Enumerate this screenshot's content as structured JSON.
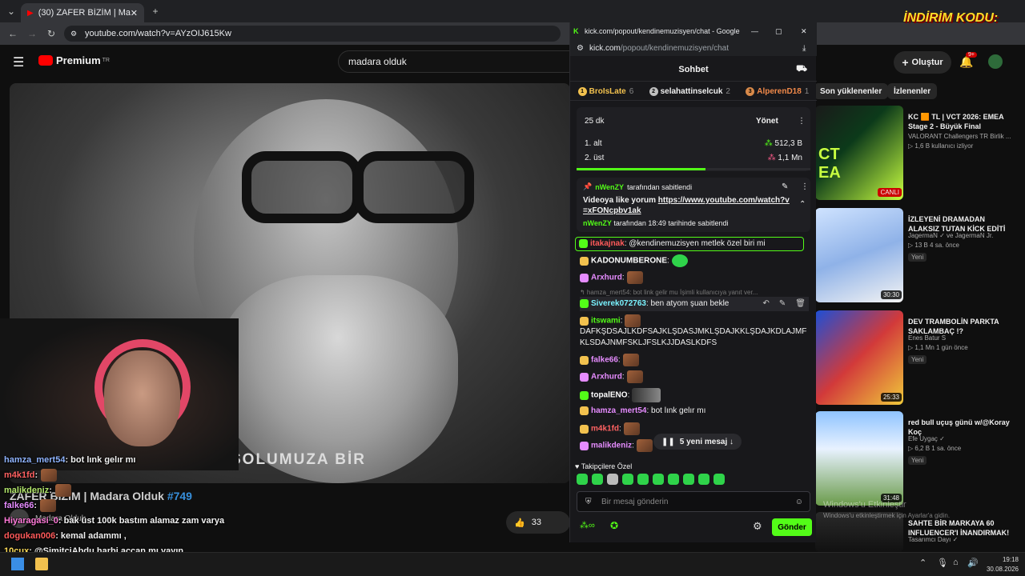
{
  "browser": {
    "tab_title": "(30) ZAFER BİZİM | Madara Old",
    "address": "youtube.com/watch?v=AYzOIJ615Kw"
  },
  "youtube": {
    "brand": "Premium",
    "region": "TR",
    "search_query": "madara olduk",
    "create_label": "Oluştur",
    "notif_count": "9+",
    "video_subtitle": "SOLUMUZA BİR",
    "video_title": "ZAFER BİZİM | Madara Olduk",
    "hashtag": "#749",
    "channel": "Madara Olduk",
    "like_count": "33",
    "chips": [
      "Son yüklenenler",
      "İzlenenler"
    ],
    "recommendations": [
      {
        "title": "KC 🟧 TL | VCT 2026: EMEA Stage 2 - Büyük Final",
        "channel": "VALORANT Challengers TR Birlik ...",
        "meta": "▷ 1,6 B kullanıcı izliyor",
        "badge": "CANLI",
        "new": ""
      },
      {
        "title": "İZLEYENİ DRAMADAN ALAKSIZ TUTAN KİCK EDİTİ",
        "channel": "JagermaN ✓ ve JagermaN Jr.",
        "meta": "▷ 13 B  4 sa. önce",
        "badge": "30:30",
        "new": "Yeni"
      },
      {
        "title": "DEV TRAMBOLİN PARKTA SAKLAMBAÇ !?",
        "channel": "Enes Batur S",
        "meta": "▷ 1,1 Mn  1 gün önce",
        "badge": "25:33",
        "new": "Yeni"
      },
      {
        "title": "red bull uçuş günü w/@Koray Koç",
        "channel": "Efe Uygaç ✓",
        "meta": "▷ 6,2 B  1 sa. önce",
        "badge": "31:48",
        "new": "Yeni"
      },
      {
        "title": "SAHTE BİR MARKAYA 60 INFLUENCER'I İNANDIRMAK!",
        "channel": "Tasarımcı Dayı ✓",
        "meta": "",
        "badge": "",
        "new": ""
      }
    ]
  },
  "overlay_chat": [
    {
      "user": "hamza_mert54",
      "text": ": bot lınk gelır mı",
      "color": "#8fb4ff"
    },
    {
      "user": "m4k1fd",
      "text": ":",
      "color": "#ff6262"
    },
    {
      "user": "malikdeniz",
      "text": ":",
      "color": "#b3e86c"
    },
    {
      "user": "falke66",
      "text": ":",
      "color": "#e68cff"
    },
    {
      "user": "Hiyaragasi_0",
      "text": ": bak üst 100k bastım alamaz zam varya",
      "color": "#ff7ad9"
    },
    {
      "user": "dogukan006",
      "text": ": kemal adammı ,",
      "color": "#ff5a5a"
    },
    {
      "user": "10cux",
      "text": ": @SimitciAbdu harbi açcan mı yayın",
      "color": "#ffde5a"
    },
    {
      "user": "hamza_mert54",
      "text": ": bot lınk gelır mı",
      "color": "#8fb4ff"
    }
  ],
  "kick": {
    "window_title": "kick.com/popout/kendinemuzisyen/chat - Google Chr...",
    "url_host": "kick.com",
    "url_path": "/popout/kendinemuzisyen/chat",
    "header": "Sohbet",
    "leaderboard": [
      {
        "rank": "1",
        "name": "BroIsLate",
        "count": "6"
      },
      {
        "rank": "2",
        "name": "selahattinselcuk",
        "count": "2"
      },
      {
        "rank": "3",
        "name": "AlperenD18",
        "count": "1"
      }
    ],
    "poll": {
      "time": "25 dk",
      "manage": "Yönet",
      "options": [
        {
          "label": "1. alt",
          "value": "512,3 B"
        },
        {
          "label": "2. üst",
          "value": "1,1 Mn"
        }
      ],
      "progress": 0.55
    },
    "pinned": {
      "by_user": "nWenZY",
      "by_label": "tarafından sabitlendi",
      "text": "Videoya like yorum",
      "link": "https://www.youtube.com/watch?v=xFONcpbv1ak",
      "footer_user": "nWenZY",
      "footer_text": "tarafından 18:49 tarihinde sabitlendi"
    },
    "messages": [
      {
        "user": "itakajnak",
        "text": ": @kendinemuzisyen metlek özel biri mi",
        "color": "#ff5a5a"
      },
      {
        "user": "KADONUMBERONE",
        "text": ":",
        "color": "#ffffff"
      },
      {
        "user": "Arxhurd",
        "text": ":",
        "color": "#e68cff"
      },
      {
        "reply": "↰ hamza_mert54: bot link gelir mu İşimli kullanıcıya yanıt ver..."
      },
      {
        "user": "Siverek072763",
        "text": ": ben atyom şuan bekle",
        "color": "#7af3ff"
      },
      {
        "user": "itswami",
        "text": ":",
        "color": "#53fc18"
      },
      {
        "long": "DAFKŞDSAJLKDFSAJKLŞDASJMKLŞDAJKKLŞDAJKDLAJMFKLSDAJNMFSKLJFSLKJJDASLKDFS"
      },
      {
        "user": "falke66",
        "text": ":",
        "color": "#e68cff"
      },
      {
        "user": "Arxhurd",
        "text": ":",
        "color": "#e68cff"
      },
      {
        "user": "topalENO",
        "text": ":",
        "color": "#ffffff"
      },
      {
        "user": "hamza_mert54",
        "text": ": bot lınk gelır mı",
        "color": "#e68cff"
      },
      {
        "user": "m4k1fd",
        "text": ":",
        "color": "#ff6262"
      },
      {
        "user": "malikdeniz",
        "text": ":",
        "color": "#e68cff"
      }
    ],
    "new_messages": "5 yeni mesaj ↓",
    "followers_only": "Takipçilere Özel",
    "input_placeholder": "Bir mesaj gönderin",
    "send": "Gönder"
  },
  "overlay_promo": "İNDİRİM KODU:",
  "windows_activate": [
    "Windows'u Etkinleştir",
    "Windows'u etkinleştirmek için Ayarlar'a gidin."
  ],
  "clock": {
    "time": "19:18",
    "date": "30.08.2026"
  },
  "colors": {
    "kick_green": "#53fc18",
    "yt_red": "#ff0000"
  }
}
